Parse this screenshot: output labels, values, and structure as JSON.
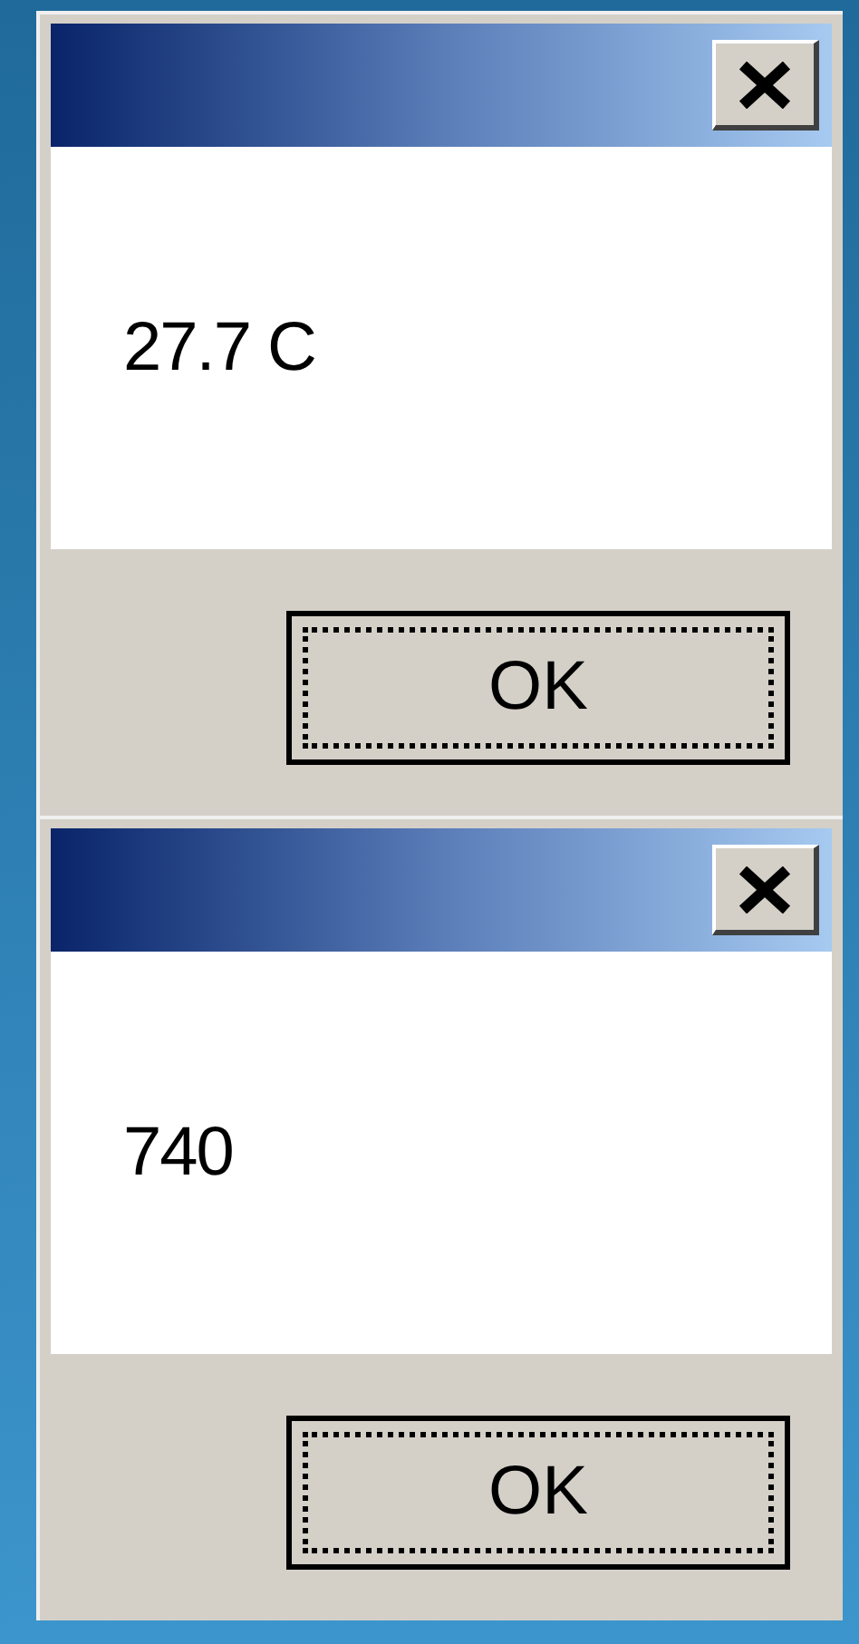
{
  "dialogs": [
    {
      "message": "27.7 C",
      "button": "OK"
    },
    {
      "message": "740",
      "button": "OK"
    }
  ]
}
